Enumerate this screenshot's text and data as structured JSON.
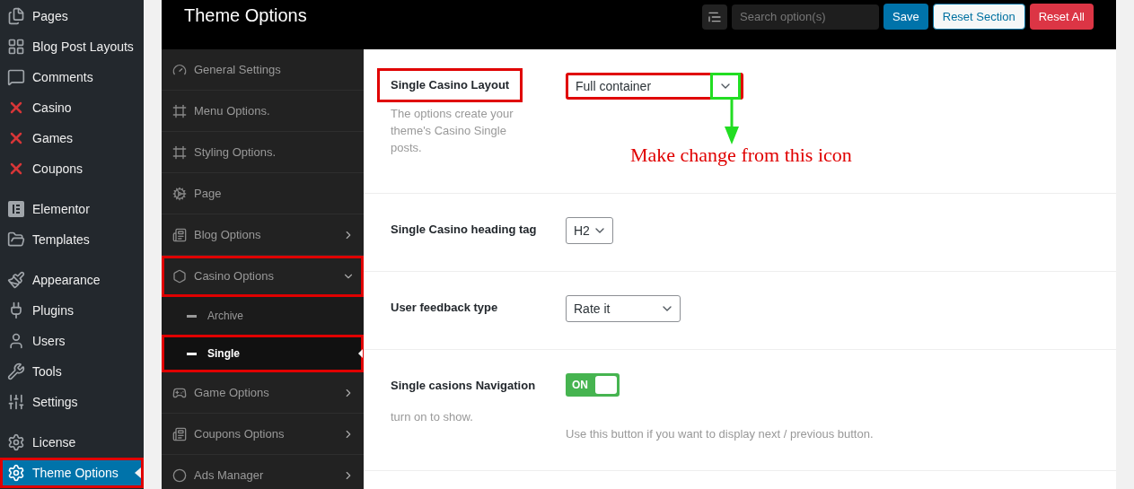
{
  "admin_menu": {
    "groups": [
      [
        {
          "label": "Pages",
          "selected": false,
          "highlighted": false
        },
        {
          "label": "Blog Post Layouts",
          "selected": false,
          "highlighted": false
        },
        {
          "label": "Comments",
          "selected": false,
          "highlighted": false
        },
        {
          "label": "Casino",
          "selected": false,
          "highlighted": false
        },
        {
          "label": "Games",
          "selected": false,
          "highlighted": false
        },
        {
          "label": "Coupons",
          "selected": false,
          "highlighted": false
        }
      ],
      [
        {
          "label": "Elementor",
          "selected": false,
          "highlighted": false
        },
        {
          "label": "Templates",
          "selected": false,
          "highlighted": false
        }
      ],
      [
        {
          "label": "Appearance",
          "selected": false,
          "highlighted": false
        },
        {
          "label": "Plugins",
          "selected": false,
          "highlighted": false
        },
        {
          "label": "Users",
          "selected": false,
          "highlighted": false
        },
        {
          "label": "Tools",
          "selected": false,
          "highlighted": false
        },
        {
          "label": "Settings",
          "selected": false,
          "highlighted": false
        }
      ],
      [
        {
          "label": "License",
          "selected": false,
          "highlighted": false
        },
        {
          "label": "Theme Options",
          "selected": true,
          "highlighted": true
        }
      ]
    ]
  },
  "theme_panel": {
    "title": "Theme Options",
    "search": {
      "placeholder": "Search option(s)"
    },
    "buttons": [
      {
        "label": "Save",
        "kind": "primary"
      },
      {
        "label": "Reset Section",
        "kind": "secondary"
      },
      {
        "label": "Reset All",
        "kind": "danger"
      }
    ],
    "nav": [
      {
        "label": "General Settings",
        "selected": false,
        "highlighted": false,
        "has_children": false
      },
      {
        "label": "Menu Options.",
        "selected": false,
        "highlighted": false,
        "has_children": false
      },
      {
        "label": "Styling Options.",
        "selected": false,
        "highlighted": false,
        "has_children": false
      },
      {
        "label": "Page",
        "selected": false,
        "highlighted": false,
        "has_children": false
      },
      {
        "label": "Blog Options",
        "selected": false,
        "highlighted": false,
        "has_children": true,
        "expanded": false
      },
      {
        "label": "Casino Options",
        "selected": false,
        "highlighted": true,
        "has_children": true,
        "expanded": true,
        "children": [
          {
            "label": "Archive",
            "selected": false,
            "highlighted": false
          },
          {
            "label": "Single",
            "selected": true,
            "highlighted": true
          }
        ]
      },
      {
        "label": "Game Options",
        "selected": false,
        "highlighted": false,
        "has_children": true,
        "expanded": false
      },
      {
        "label": "Coupons Options",
        "selected": false,
        "highlighted": false,
        "has_children": true,
        "expanded": false
      },
      {
        "label": "Ads Manager",
        "selected": false,
        "highlighted": false,
        "has_children": true,
        "expanded": false
      }
    ],
    "fields": [
      {
        "kind": "select",
        "label": "Single Casino Layout",
        "description": "The options create your theme's Casino Single posts.",
        "value": "Full container",
        "highlighted": true,
        "chevron_highlighted": true,
        "note": "Make change from this icon"
      },
      {
        "kind": "select",
        "label": "Single Casino heading tag",
        "value": "H2",
        "highlighted": false,
        "chevron_highlighted": false
      },
      {
        "kind": "select",
        "label": "User feedback type",
        "value": "Rate it",
        "highlighted": false,
        "chevron_highlighted": false
      },
      {
        "kind": "toggle",
        "label": "Single casions Navigation",
        "description": "turn on to show.",
        "on": true,
        "on_label": "ON",
        "help": "Use this button if you want to display next / previous button."
      }
    ]
  }
}
